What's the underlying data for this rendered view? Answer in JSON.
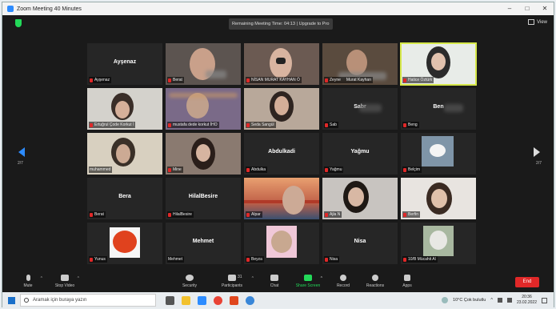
{
  "window": {
    "title": "Zoom Meeting 40 Minutes"
  },
  "meeting": {
    "remaining_label": "Remaining Meeting Time: 04:13",
    "upgrade_label": "Upgrade to Pro",
    "view_label": "View"
  },
  "pager": {
    "left": "2/7",
    "right": "2/7"
  },
  "tiles": [
    {
      "big": "Ayşenaz",
      "label": "Ayşenaz"
    },
    {
      "big": "",
      "label": "Berat"
    },
    {
      "big": "",
      "label": "NİSAN MURAT KAYHAN Ö"
    },
    {
      "big": "",
      "label": "Zeyne"
    },
    {
      "big": "",
      "label": "Murat Kayhan"
    },
    {
      "big": "",
      "label": "Hatice Öztürk"
    },
    {
      "big": "",
      "label": "Ertuğrul Çode Korkut İ"
    },
    {
      "big": "",
      "label": "mustafa dede korkut İHO"
    },
    {
      "big": "",
      "label": "Seda Sangül"
    },
    {
      "big": "Sabr",
      "label": "Sab"
    },
    {
      "big": "Ben",
      "label": "Beng"
    },
    {
      "big": "",
      "label": "muhammed"
    },
    {
      "big": "",
      "label": "Mine"
    },
    {
      "big": "Abdulkadi",
      "label": "Abdulka"
    },
    {
      "big": "Yağmu",
      "label": "Yağmu"
    },
    {
      "big": "",
      "label": "Belçim"
    },
    {
      "big": "Bera",
      "label": "Berat"
    },
    {
      "big": "HilalBesire",
      "label": "HilalBesire"
    },
    {
      "big": "",
      "label": "Alpar"
    },
    {
      "big": "",
      "label": "Ajla N"
    },
    {
      "big": "",
      "label": "Berfin"
    },
    {
      "big": "",
      "label": "Yunus"
    },
    {
      "big": "Mehmet",
      "label": "Mehmet"
    },
    {
      "big": "",
      "label": "Beyza"
    },
    {
      "big": "Nisa",
      "label": "Nisa"
    },
    {
      "big": "",
      "label": "10/B Mücahit Al"
    }
  ],
  "toolbar": {
    "mute": "Mute",
    "stop_video": "Stop Video",
    "security": "Security",
    "participants": "Participants",
    "participants_count": "31",
    "chat": "Chat",
    "share_screen": "Share Screen",
    "record": "Record",
    "reactions": "Reactions",
    "apps": "Apps",
    "end": "End"
  },
  "taskbar": {
    "search_placeholder": "Aramak için buraya yazın",
    "weather": "10°C  Çok bulutlu",
    "time": "20:36",
    "date": "23.02.2022"
  }
}
